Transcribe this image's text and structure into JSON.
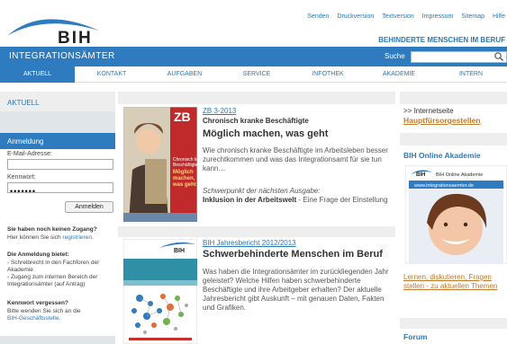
{
  "header": {
    "logo_text": "BIH",
    "top_links": [
      "Senden",
      "Druckversion",
      "Textversion",
      "Impressum",
      "Sitemap",
      "Hilfe"
    ],
    "tagline": "BEHINDERTE MENSCHEN IM BERUF"
  },
  "bluebar": {
    "site_title": "INTEGRATIONSÄMTER",
    "search_label": "Suche",
    "search_value": ""
  },
  "nav": {
    "items": [
      "AKTUELL",
      "KONTAKT",
      "AUFGABEN",
      "SERVICE",
      "INFOTHEK",
      "AKADEMIE",
      "INTERN"
    ],
    "active": "AKTUELL"
  },
  "left": {
    "section_title": "AKTUELL",
    "login_title": "Anmeldung",
    "email_label": "E-Mail-Adresse:",
    "email_value": "",
    "password_label": "Kennwort:",
    "password_value": "•••••••",
    "login_button": "Anmelden",
    "no_access_title": "Sie haben noch keinen Zugang?",
    "no_access_text": "Hier können Sie sich ",
    "register_link": "registrieren.",
    "benefits_title": "Die Anmeldung bietet:",
    "benefit_1": "- Schreibrecht in den Fachforen der Akademie",
    "benefit_2": "- Zugang zum internen Bereich der Integrationsämter (auf Antrag)",
    "forgot_title": "Kennwort vergessen?",
    "forgot_text": "Bitte wenden Sie sich an die ",
    "forgot_link": "BIH-Geschäftsstelle."
  },
  "main": {
    "teaser1": {
      "kicker": "ZB 3-2013",
      "subkicker": "Chronisch kranke Beschäftigte",
      "headline": "Möglich machen, was geht",
      "body": "Wie chronisch kranke Beschäftigte im Arbeitsleben besser zurechtkommen und was das Integrationsamt für sie tun kann…",
      "next_label": "Schwerpunkt der nächsten Ausgabe:",
      "next_title": "Inklusion in der Arbeitswelt",
      "next_rest": " - Eine Frage der Einstellung",
      "cover_logo": "ZB",
      "cover_text": "Chronisch kranke Beschäftigte\nMöglich machen, was geht"
    },
    "teaser2": {
      "kicker": "BIH Jahresbericht 2012/2013",
      "headline": "Schwerbehinderte Menschen im Beruf",
      "body": "Was haben die Integrationsämter im zurückliegenden Jahr geleistet? Welche Hilfen haben schwerbehinderte Beschäftigte und ihre Arbeitgeber erhalten? Der aktuelle Jahresbericht gibt Auskunft – mit genauen Daten, Fakten und Grafiken.",
      "cover_logo": "BIH"
    }
  },
  "right": {
    "internet_label": ">> Internetseite",
    "internet_link": "Hauptfürsorgestellen",
    "akademie_title": "BIH Online Akademie",
    "banner_brand": "BIH Online Akademie",
    "banner_url": "www.integrationsaemter.de",
    "learn_link": "Lernen, diskutieren, Fragen stellen - zu aktuellen Themen",
    "forum_title": "Forum"
  },
  "colors": {
    "brand_blue": "#2f7bbf",
    "link_blue": "#2a7ab8",
    "accent_orange": "#c17a2b"
  }
}
